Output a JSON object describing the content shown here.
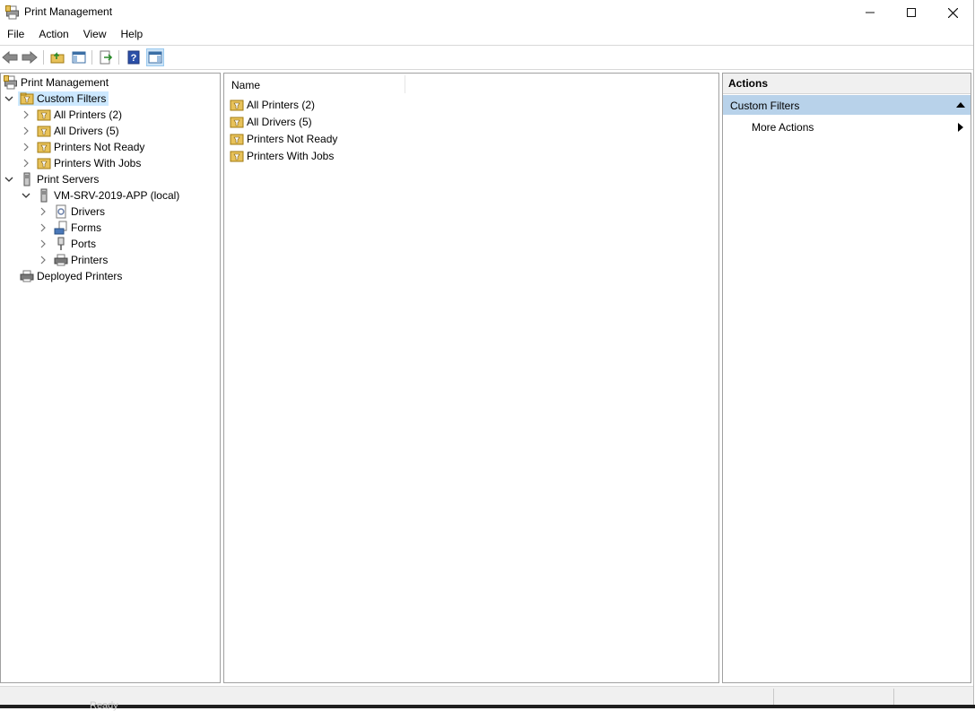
{
  "window": {
    "title": "Print Management"
  },
  "menu": [
    "File",
    "Action",
    "View",
    "Help"
  ],
  "toolbar": {
    "icons": [
      "back-arrow-icon",
      "forward-arrow-icon",
      "up-folder-icon",
      "show-hide-tree-icon",
      "export-list-icon",
      "help-icon",
      "show-hide-action-pane-icon"
    ]
  },
  "tree": {
    "root": "Print Management",
    "custom_filters": "Custom Filters",
    "filters": [
      "All Printers (2)",
      "All Drivers (5)",
      "Printers Not Ready",
      "Printers With Jobs"
    ],
    "print_servers": "Print Servers",
    "server": "VM-SRV-2019-APP (local)",
    "server_children": [
      "Drivers",
      "Forms",
      "Ports",
      "Printers"
    ],
    "deployed": "Deployed Printers"
  },
  "list": {
    "column_name": "Name",
    "items": [
      "All Printers (2)",
      "All Drivers (5)",
      "Printers Not Ready",
      "Printers With Jobs"
    ]
  },
  "actions": {
    "title": "Actions",
    "section": "Custom Filters",
    "items": [
      "More Actions"
    ]
  },
  "background": {
    "partial_text": "Ready"
  },
  "colors": {
    "selection": "#cce8ff",
    "action_section": "#b8d2ea"
  }
}
